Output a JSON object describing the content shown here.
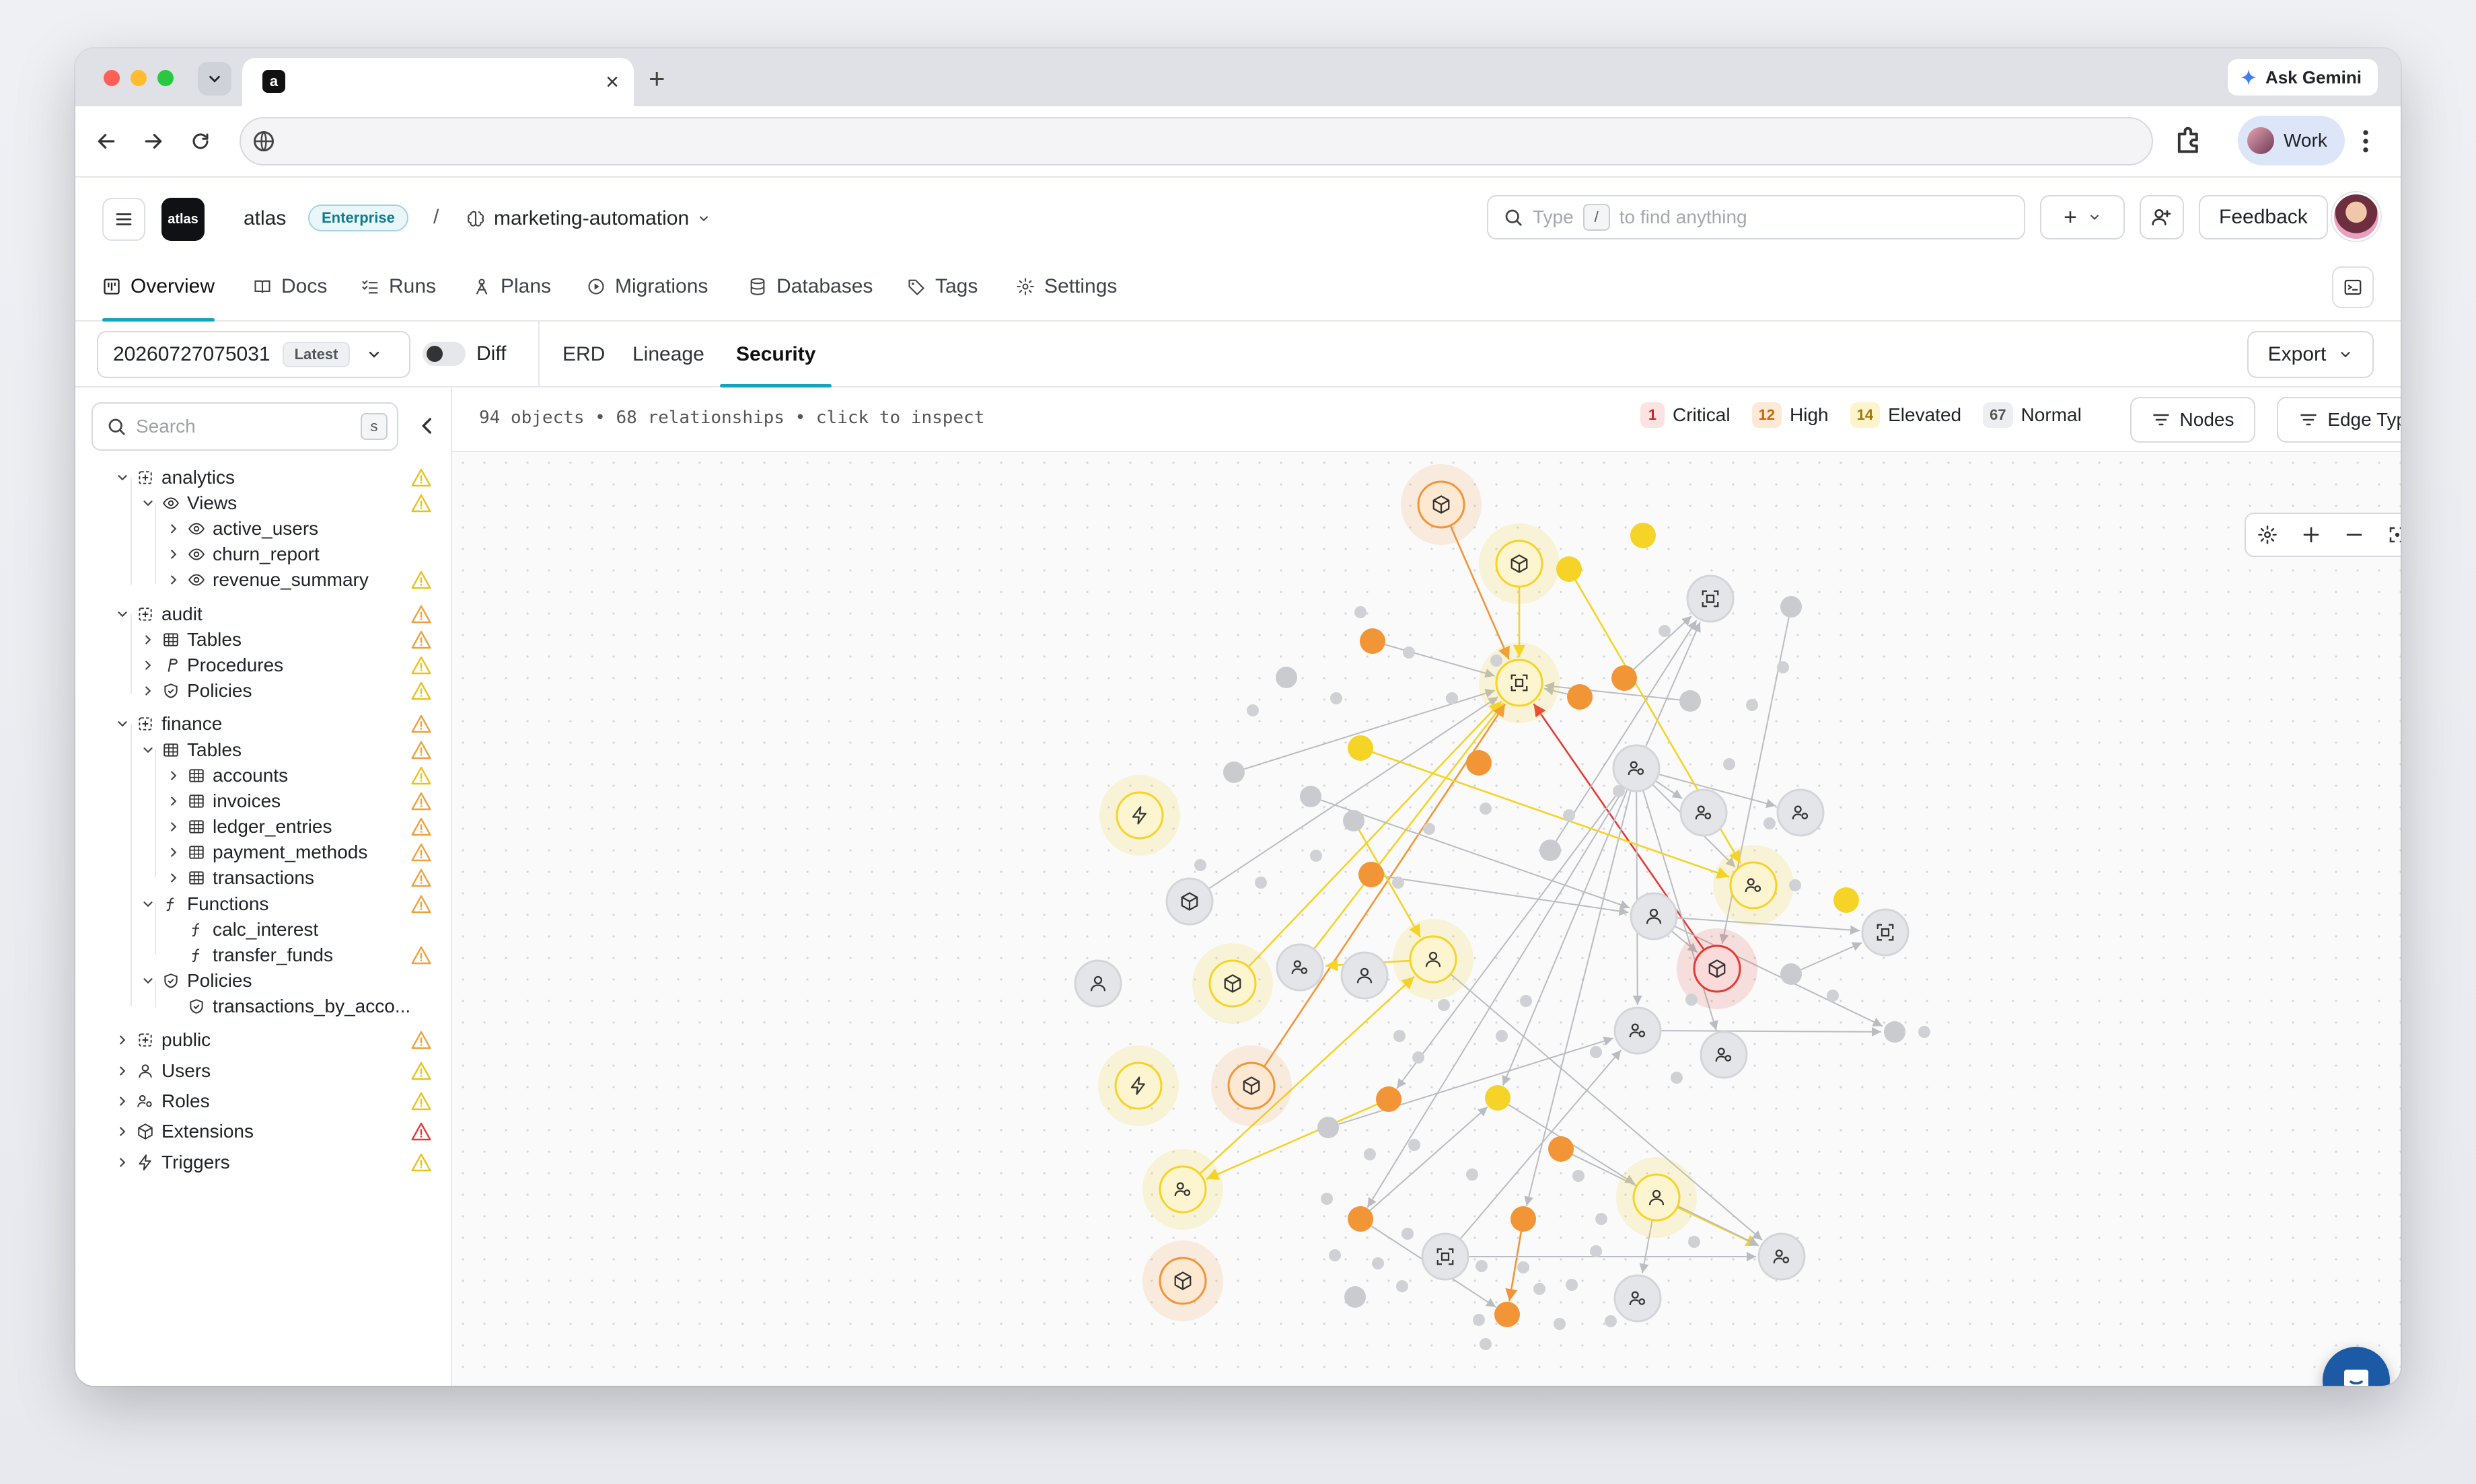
{
  "browser": {
    "tab_favicon_letter": "a",
    "tab_close": "×",
    "new_tab": "+",
    "ask_gemini": "Ask Gemini",
    "profile_label": "Work"
  },
  "header": {
    "logo_text": "atlas",
    "org_name": "atlas",
    "plan_badge": "Enterprise",
    "separator": "/",
    "project_name": "marketing-automation",
    "search_placeholder_pre": "Type",
    "search_key": "/",
    "search_placeholder_post": "to find anything",
    "add_label": "+",
    "feedback": "Feedback"
  },
  "main_tabs": [
    {
      "label": "Overview",
      "icon": "overview-icon"
    },
    {
      "label": "Docs",
      "icon": "book-icon"
    },
    {
      "label": "Runs",
      "icon": "list-check-icon"
    },
    {
      "label": "Plans",
      "icon": "plan-icon"
    },
    {
      "label": "Migrations",
      "icon": "play-circle-icon"
    },
    {
      "label": "Databases",
      "icon": "database-icon"
    },
    {
      "label": "Tags",
      "icon": "tag-icon"
    },
    {
      "label": "Settings",
      "icon": "gear-icon"
    }
  ],
  "toolbar": {
    "version": "20260727075031",
    "latest_badge": "Latest",
    "diff_label": "Diff",
    "views": [
      "ERD",
      "Lineage",
      "Security"
    ],
    "active_view": "Security",
    "export_label": "Export"
  },
  "sidebar": {
    "search_placeholder": "Search",
    "search_key": "s",
    "tree": [
      {
        "label": "analytics",
        "icon": "schema-icon",
        "level": 0,
        "expanded": true,
        "warn": "yellow"
      },
      {
        "label": "Views",
        "icon": "eye-icon",
        "level": 1,
        "expanded": true,
        "warn": "yellow"
      },
      {
        "label": "active_users",
        "icon": "eye-icon",
        "level": 2,
        "expanded": false,
        "warn": ""
      },
      {
        "label": "churn_report",
        "icon": "eye-icon",
        "level": 2,
        "expanded": false,
        "warn": ""
      },
      {
        "label": "revenue_summary",
        "icon": "eye-icon",
        "level": 2,
        "expanded": false,
        "warn": "yellow"
      },
      {
        "label": "audit",
        "icon": "schema-icon",
        "level": 0,
        "expanded": true,
        "warn": "orange"
      },
      {
        "label": "Tables",
        "icon": "table-icon",
        "level": 1,
        "expanded": false,
        "warn": "orange"
      },
      {
        "label": "Procedures",
        "icon": "procedure-icon",
        "level": 1,
        "expanded": false,
        "warn": "yellow"
      },
      {
        "label": "Policies",
        "icon": "shield-icon",
        "level": 1,
        "expanded": false,
        "warn": "yellow"
      },
      {
        "label": "finance",
        "icon": "schema-icon",
        "level": 0,
        "expanded": true,
        "warn": "orange"
      },
      {
        "label": "Tables",
        "icon": "table-icon",
        "level": 1,
        "expanded": true,
        "warn": "orange"
      },
      {
        "label": "accounts",
        "icon": "table-icon",
        "level": 2,
        "expanded": false,
        "warn": "yellow"
      },
      {
        "label": "invoices",
        "icon": "table-icon",
        "level": 2,
        "expanded": false,
        "warn": "orange"
      },
      {
        "label": "ledger_entries",
        "icon": "table-icon",
        "level": 2,
        "expanded": false,
        "warn": "orange"
      },
      {
        "label": "payment_methods",
        "icon": "table-icon",
        "level": 2,
        "expanded": false,
        "warn": "orange"
      },
      {
        "label": "transactions",
        "icon": "table-icon",
        "level": 2,
        "expanded": false,
        "warn": "orange"
      },
      {
        "label": "Functions",
        "icon": "function-icon",
        "level": 1,
        "expanded": true,
        "warn": "orange"
      },
      {
        "label": "calc_interest",
        "icon": "function-icon",
        "level": 2,
        "leaf": true,
        "warn": ""
      },
      {
        "label": "transfer_funds",
        "icon": "function-icon",
        "level": 2,
        "leaf": true,
        "warn": "orange"
      },
      {
        "label": "Policies",
        "icon": "shield-icon",
        "level": 1,
        "expanded": true,
        "warn": ""
      },
      {
        "label": "transactions_by_acco...",
        "icon": "shield-icon",
        "level": 2,
        "leaf": true,
        "warn": ""
      },
      {
        "label": "public",
        "icon": "schema-icon",
        "level": 0,
        "expanded": false,
        "warn": "orange"
      },
      {
        "label": "Users",
        "icon": "user-icon",
        "level": 0,
        "expanded": false,
        "warn": "yellow"
      },
      {
        "label": "Roles",
        "icon": "roles-icon",
        "level": 0,
        "expanded": false,
        "warn": "yellow"
      },
      {
        "label": "Extensions",
        "icon": "box-icon",
        "level": 0,
        "expanded": false,
        "warn": "red"
      },
      {
        "label": "Triggers",
        "icon": "bolt-icon",
        "level": 0,
        "expanded": false,
        "warn": "yellow"
      }
    ]
  },
  "canvas": {
    "summary": "94 objects • 68 relationships • click to inspect",
    "severity": [
      {
        "count": "1",
        "label": "Critical",
        "chip_bg": "#fde2e2",
        "chip_fg": "#c62828"
      },
      {
        "count": "12",
        "label": "High",
        "chip_bg": "#fde9d4",
        "chip_fg": "#c26a12"
      },
      {
        "count": "14",
        "label": "Elevated",
        "chip_bg": "#fdf4cc",
        "chip_fg": "#9c7a05"
      },
      {
        "count": "67",
        "label": "Normal",
        "chip_bg": "#eceef1",
        "chip_fg": "#555555"
      }
    ],
    "nodes_button": "Nodes",
    "edge_types_button": "Edge Types"
  },
  "colors": {
    "accent": "#15a5bb",
    "critical": "#e53935",
    "high": "#f29537",
    "elevated": "#f5d327",
    "normal": "#c9cbcf"
  }
}
